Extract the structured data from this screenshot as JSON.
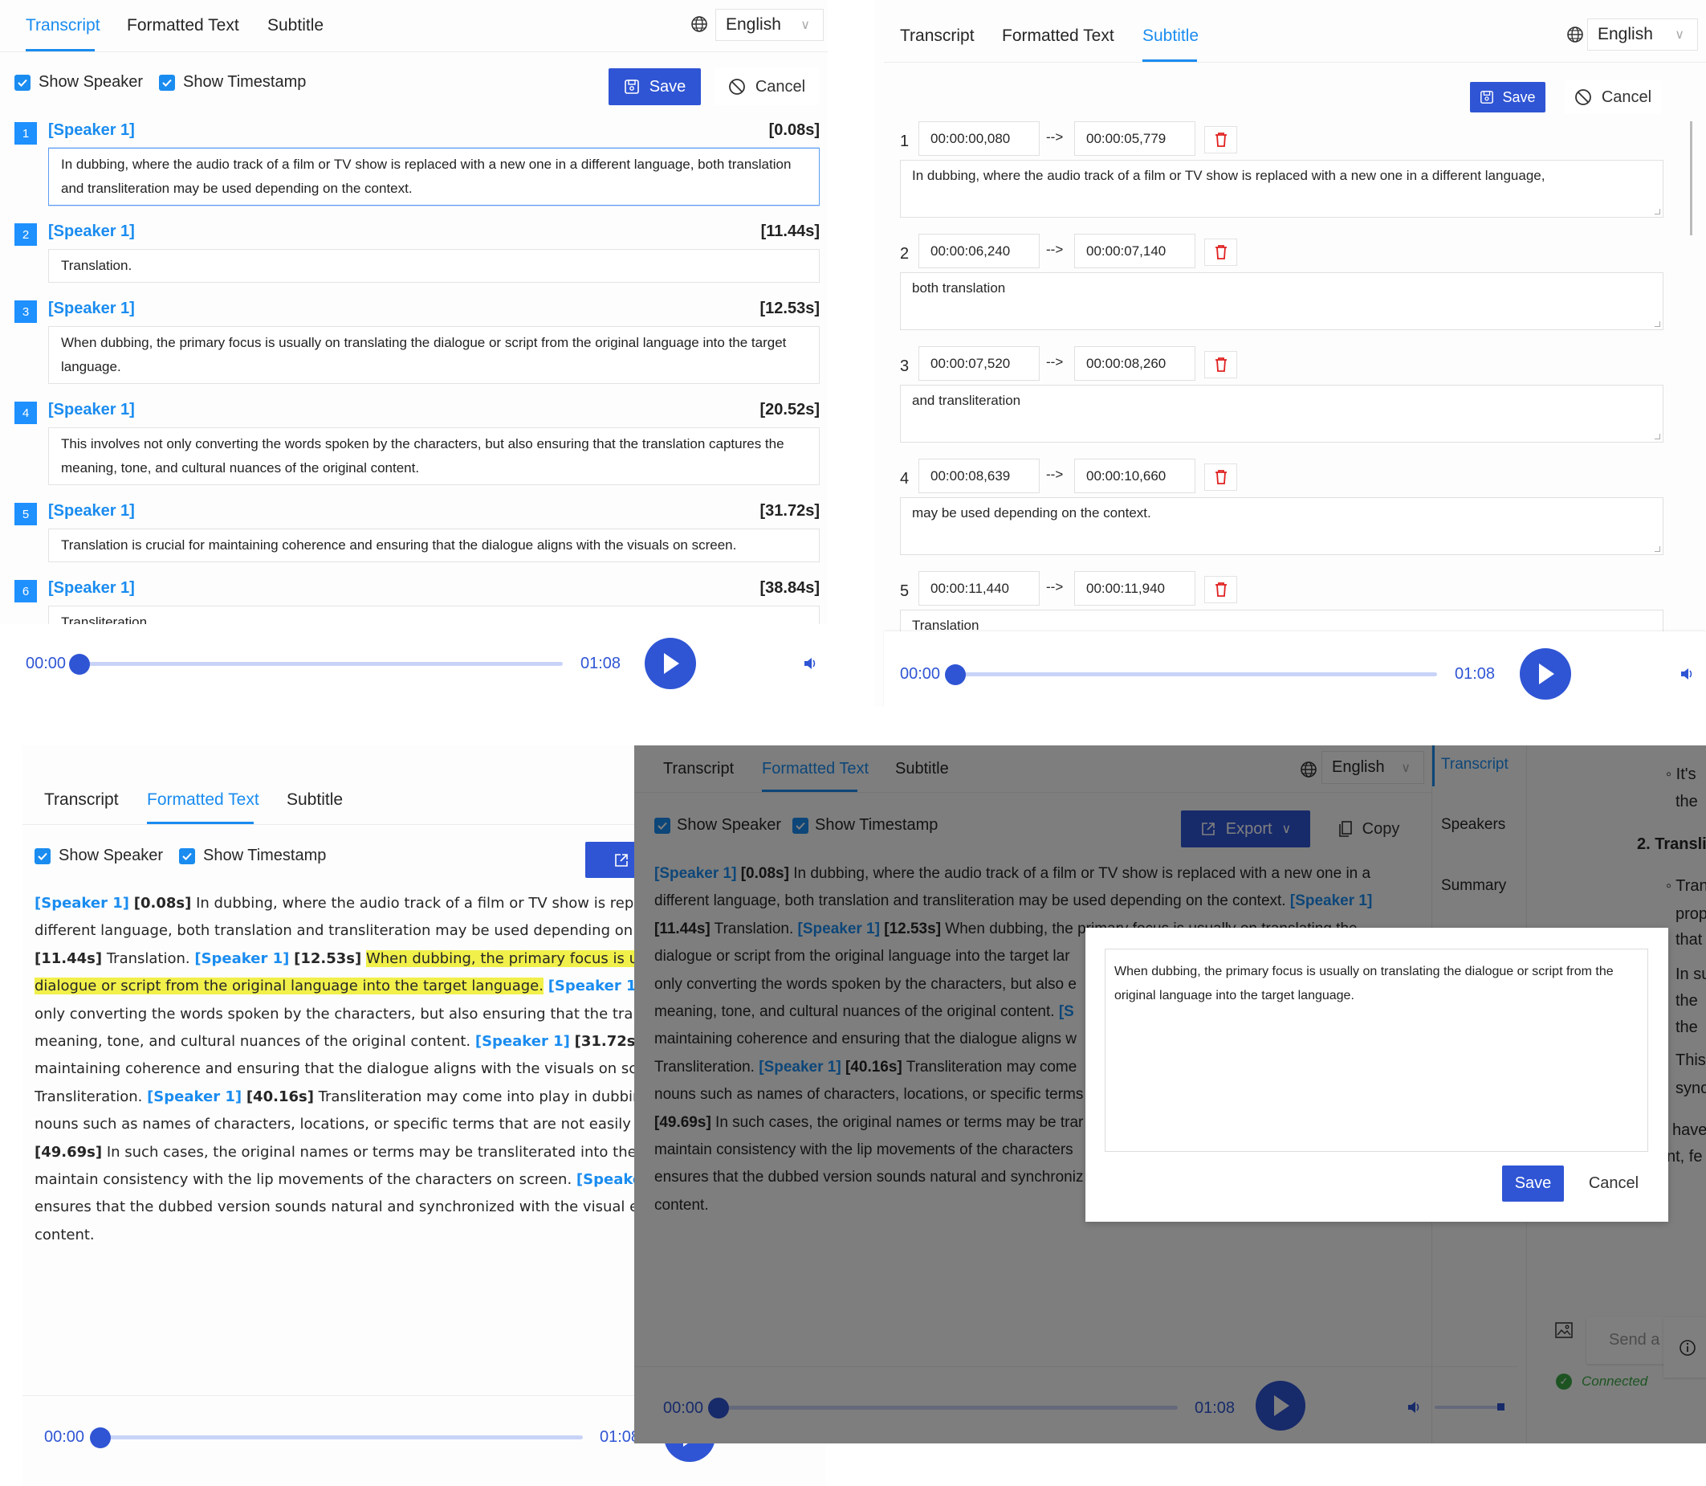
{
  "tabs": [
    "Transcript",
    "Formatted Text",
    "Subtitle"
  ],
  "language": "English",
  "options": {
    "show_speaker": "Show Speaker",
    "show_timestamp": "Show Timestamp"
  },
  "buttons": {
    "save": "Save",
    "cancel": "Cancel",
    "export": "Export",
    "copy": "Copy"
  },
  "player": {
    "current": "00:00",
    "duration": "01:08",
    "progress": 0
  },
  "colors": {
    "accent": "#1a8cf0",
    "primary": "#2f55d4",
    "highlight": "#f1f04a",
    "delete": "#e02020"
  },
  "transcript_panel": {
    "active_tab": "Transcript",
    "segments": [
      {
        "index": "1",
        "speaker": "[Speaker 1]",
        "time": "[0.08s]",
        "text": "In dubbing, where the audio track of a film or TV show is replaced with a new one in a different language, both translation and transliteration may be used depending on the context.",
        "focused": true
      },
      {
        "index": "2",
        "speaker": "[Speaker 1]",
        "time": "[11.44s]",
        "text": "Translation."
      },
      {
        "index": "3",
        "speaker": "[Speaker 1]",
        "time": "[12.53s]",
        "text": "When dubbing, the primary focus is usually on translating the dialogue or script from the original language into the target language."
      },
      {
        "index": "4",
        "speaker": "[Speaker 1]",
        "time": "[20.52s]",
        "text": "This involves not only converting the words spoken by the characters, but also ensuring that the translation captures the meaning, tone, and cultural nuances of the original content."
      },
      {
        "index": "5",
        "speaker": "[Speaker 1]",
        "time": "[31.72s]",
        "text": "Translation is crucial for maintaining coherence and ensuring that the dialogue aligns with the visuals on screen."
      },
      {
        "index": "6",
        "speaker": "[Speaker 1]",
        "time": "[38.84s]",
        "text": "Transliteration."
      }
    ]
  },
  "subtitle_panel": {
    "active_tab": "Subtitle",
    "arrow": "-->",
    "cues": [
      {
        "index": "1",
        "start": "00:00:00,080",
        "end": "00:00:05,779",
        "text": "In dubbing, where the audio track of a film or TV show is replaced with a new one in a different language,"
      },
      {
        "index": "2",
        "start": "00:00:06,240",
        "end": "00:00:07,140",
        "text": "both translation"
      },
      {
        "index": "3",
        "start": "00:00:07,520",
        "end": "00:00:08,260",
        "text": "and transliteration"
      },
      {
        "index": "4",
        "start": "00:00:08,639",
        "end": "00:00:10,660",
        "text": "may be used depending on the context."
      },
      {
        "index": "5",
        "start": "00:00:11,440",
        "end": "00:00:11,940",
        "text": "Translation"
      }
    ]
  },
  "formatted_panel": {
    "active_tab": "Formatted Text",
    "lines": [
      [
        {
          "k": "s",
          "v": "[Speaker 1]"
        },
        {
          "k": "x",
          "v": " "
        },
        {
          "k": "t",
          "v": "[0.08s]"
        },
        {
          "k": "x",
          "v": " In dubbing, where the audio track of a film or TV show is replac"
        }
      ],
      [
        {
          "k": "x",
          "v": "different language, both translation and transliteration may be used depending on t"
        }
      ],
      [
        {
          "k": "t",
          "v": "[11.44s]"
        },
        {
          "k": "x",
          "v": " Translation. "
        },
        {
          "k": "s",
          "v": "[Speaker 1]"
        },
        {
          "k": "x",
          "v": " "
        },
        {
          "k": "t",
          "v": "[12.53s]"
        },
        {
          "k": "x",
          "v": " "
        },
        {
          "k": "h",
          "v": "When dubbing, the primary focus is usua"
        }
      ],
      [
        {
          "k": "h",
          "v": "dialogue or script from the original language into the target language."
        },
        {
          "k": "x",
          "v": " "
        },
        {
          "k": "s",
          "v": "[Speaker 1]"
        }
      ],
      [
        {
          "k": "x",
          "v": "only converting the words spoken by the characters, but also ensuring that the trans"
        }
      ],
      [
        {
          "k": "x",
          "v": "meaning, tone, and cultural nuances of the original content. "
        },
        {
          "k": "s",
          "v": "[Speaker 1]"
        },
        {
          "k": "x",
          "v": " "
        },
        {
          "k": "t",
          "v": "[31.72s]"
        },
        {
          "k": "x",
          "v": " Tr"
        }
      ],
      [
        {
          "k": "x",
          "v": "maintaining coherence and ensuring that the dialogue aligns with the visuals on scr"
        }
      ],
      [
        {
          "k": "x",
          "v": "Transliteration. "
        },
        {
          "k": "s",
          "v": "[Speaker 1]"
        },
        {
          "k": "x",
          "v": " "
        },
        {
          "k": "t",
          "v": "[40.16s]"
        },
        {
          "k": "x",
          "v": " Transliteration may come into play in dubbing"
        }
      ],
      [
        {
          "k": "x",
          "v": "nouns such as names of characters, locations, or specific terms that are not easily tra"
        }
      ],
      [
        {
          "k": "t",
          "v": "[49.69s]"
        },
        {
          "k": "x",
          "v": " In such cases, the original names or terms may be transliterated into the ta"
        }
      ],
      [
        {
          "k": "x",
          "v": "maintain consistency with the lip movements of the characters on screen. "
        },
        {
          "k": "s",
          "v": "[Speaker"
        }
      ],
      [
        {
          "k": "x",
          "v": "ensures that the dubbed version sounds natural and synchronized with the visual el"
        }
      ],
      [
        {
          "k": "x",
          "v": "content."
        }
      ]
    ]
  },
  "edit_panel": {
    "active_tab": "Formatted Text",
    "lines": [
      [
        {
          "k": "s",
          "v": "[Speaker 1]"
        },
        {
          "k": "x",
          "v": " "
        },
        {
          "k": "t",
          "v": "[0.08s]"
        },
        {
          "k": "x",
          "v": " In dubbing, where the audio track of a film or TV show is replaced with a new one in a"
        }
      ],
      [
        {
          "k": "x",
          "v": "different language, both translation and transliteration may be used depending on the context. "
        },
        {
          "k": "s",
          "v": "[Speaker 1]"
        }
      ],
      [
        {
          "k": "t",
          "v": "[11.44s]"
        },
        {
          "k": "x",
          "v": " Translation. "
        },
        {
          "k": "s",
          "v": "[Speaker 1]"
        },
        {
          "k": "x",
          "v": " "
        },
        {
          "k": "t",
          "v": "[12.53s]"
        },
        {
          "k": "x",
          "v": " When dubbing, the primary focus is usually on translating the"
        }
      ],
      [
        {
          "k": "x",
          "v": "dialogue or script from the original language into the target lar"
        }
      ],
      [
        {
          "k": "x",
          "v": "only converting the words spoken by the characters, but also e"
        }
      ],
      [
        {
          "k": "x",
          "v": "meaning, tone, and cultural nuances of the original content. "
        },
        {
          "k": "s",
          "v": "[S"
        }
      ],
      [
        {
          "k": "x",
          "v": "maintaining coherence and ensuring that the dialogue aligns w"
        }
      ],
      [
        {
          "k": "x",
          "v": "Transliteration. "
        },
        {
          "k": "s",
          "v": "[Speaker 1]"
        },
        {
          "k": "x",
          "v": " "
        },
        {
          "k": "t",
          "v": "[40.16s]"
        },
        {
          "k": "x",
          "v": " Transliteration may come"
        }
      ],
      [
        {
          "k": "x",
          "v": "nouns such as names of characters, locations, or specific terms"
        }
      ],
      [
        {
          "k": "t",
          "v": "[49.69s]"
        },
        {
          "k": "x",
          "v": " In such cases, the original names or terms may be trar"
        }
      ],
      [
        {
          "k": "x",
          "v": "maintain consistency with the lip movements of the characters"
        }
      ],
      [
        {
          "k": "x",
          "v": "ensures that the dubbed version sounds natural and synchroniz"
        }
      ],
      [
        {
          "k": "x",
          "v": "content."
        }
      ]
    ],
    "sidebar": [
      "Transcript",
      "Speakers",
      "Summary"
    ],
    "sidebar_active": "Transcript",
    "chat_fragments": [
      "◦ It's",
      "the",
      "2. Transli",
      "◦ Tran",
      "prop",
      "that",
      "In su",
      "the",
      "the",
      "This",
      "sync",
      "have",
      "nt, fe"
    ],
    "chat_placeholder": "Send a messa",
    "status": "Connected",
    "modal": {
      "text": "When dubbing, the primary focus is usually on translating the dialogue or script from the original language into the target language.",
      "save": "Save",
      "cancel": "Cancel"
    }
  }
}
